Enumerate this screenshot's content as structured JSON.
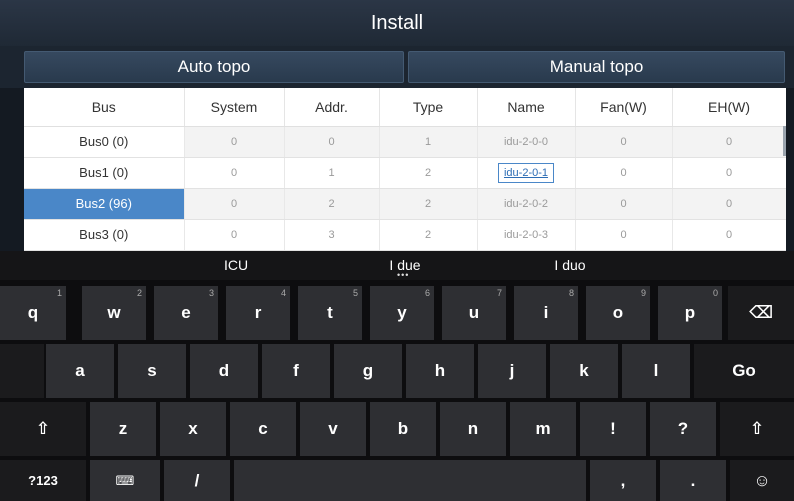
{
  "window": {
    "title": "Install"
  },
  "tabs": {
    "auto": "Auto topo",
    "manual": "Manual topo"
  },
  "table": {
    "columns": [
      "Bus",
      "System",
      "Addr.",
      "Type",
      "Name",
      "Fan(W)",
      "EH(W)"
    ],
    "rows": [
      {
        "bus": "Bus0   (0)",
        "system": "0",
        "addr": "0",
        "type": "1",
        "name": "idu-2-0-0",
        "fan": "0",
        "eh": "0"
      },
      {
        "bus": "Bus1   (0)",
        "system": "0",
        "addr": "1",
        "type": "2",
        "name": "idu-2-0-1",
        "fan": "0",
        "eh": "0"
      },
      {
        "bus": "Bus2   (96)",
        "system": "0",
        "addr": "2",
        "type": "2",
        "name": "idu-2-0-2",
        "fan": "0",
        "eh": "0"
      },
      {
        "bus": "Bus3   (0)",
        "system": "0",
        "addr": "3",
        "type": "2",
        "name": "idu-2-0-3",
        "fan": "0",
        "eh": "0"
      }
    ]
  },
  "keyboard": {
    "suggestions": [
      "ICU",
      "I due",
      "I duo"
    ],
    "row1": [
      {
        "k": "q",
        "hint": "1"
      },
      {
        "k": "w",
        "hint": "2"
      },
      {
        "k": "e",
        "hint": "3"
      },
      {
        "k": "r",
        "hint": "4"
      },
      {
        "k": "t",
        "hint": "5"
      },
      {
        "k": "y",
        "hint": "6"
      },
      {
        "k": "u",
        "hint": "7"
      },
      {
        "k": "i",
        "hint": "8"
      },
      {
        "k": "o",
        "hint": "9"
      },
      {
        "k": "p",
        "hint": "0"
      }
    ],
    "row2": [
      "a",
      "s",
      "d",
      "f",
      "g",
      "h",
      "j",
      "k",
      "l"
    ],
    "row3": [
      "z",
      "x",
      "c",
      "v",
      "b",
      "n",
      "m",
      "!",
      "?"
    ],
    "go_label": "Go",
    "symbols_label": "?123",
    "slash_label": "/",
    "comma_label": ",",
    "period_label": ".",
    "shift_glyph": "⇧",
    "lang_glyph": "⌨",
    "emoji_glyph": "☺",
    "backspace_glyph": "⌫"
  },
  "colors": {
    "selected": "#4a87c8",
    "titlebar": "#2b3646",
    "key": "#2e2f33"
  }
}
